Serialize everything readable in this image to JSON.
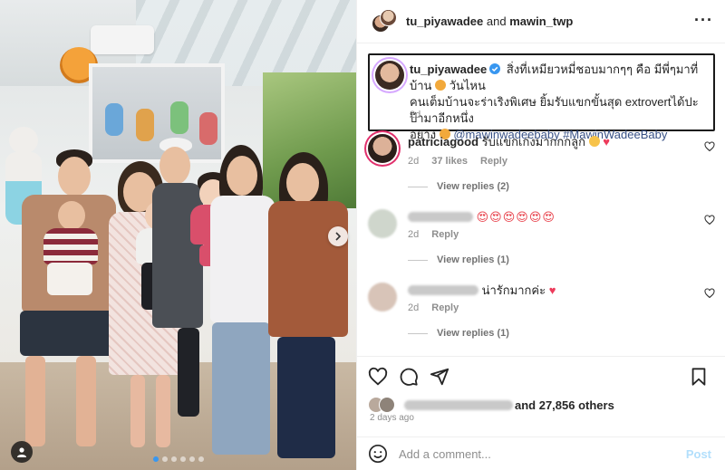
{
  "header": {
    "user1": "tu_piyawadee",
    "connector": "and",
    "user2": "mawin_twp",
    "more_icon": "more-horizontal-icon"
  },
  "caption": {
    "username": "tu_piyawadee",
    "text_line1": "สิ่งที่เหมียวหมี่ชอบมากๆๆ คือ มีพี่ๆมาที่บ้าน",
    "text_line1b": "วันไหน",
    "text_line2": "คนเต็มบ้านจะร่าเริงพิเศษ ยิ้มรับแขกขั้นสุด extrovertได้ปะป๊ามาอีกหนึ่ง",
    "text_line3": "อย่าง",
    "mentions": "@mawinwadeebaby #MawinWadeeBaby",
    "time": "2d"
  },
  "comments": [
    {
      "username": "patriciagood",
      "text": "รับแขกเก่งมากกกลูก",
      "time": "2d",
      "likes": "37 likes",
      "reply_label": "Reply",
      "view_replies": "View replies (2)"
    },
    {
      "username": "",
      "text": "",
      "time": "2d",
      "reply_label": "Reply",
      "view_replies": "View replies (1)"
    },
    {
      "username": "",
      "text": "น่ารักมากค่ะ",
      "time": "2d",
      "reply_label": "Reply",
      "view_replies": "View replies (1)"
    }
  ],
  "likes": {
    "text": "and 27,856 others"
  },
  "posted_ago": "2 days ago",
  "add_comment": {
    "placeholder": "Add a comment...",
    "post_label": "Post"
  },
  "colors": {
    "link": "#385185",
    "post_button": "#b2dffc",
    "heart_emoji": "#ed3b5b",
    "carousel_active_dot": "#3897f0"
  }
}
